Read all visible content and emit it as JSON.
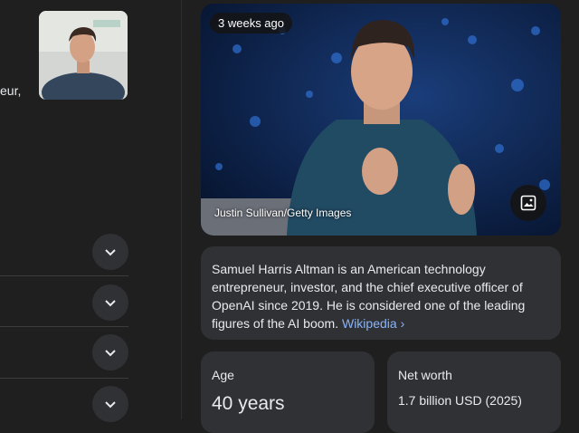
{
  "left": {
    "clipped_text": "eur,",
    "accordion_count": 4
  },
  "hero": {
    "timestamp": "3 weeks ago",
    "credit": "Justin Sullivan/Getty Images"
  },
  "description": {
    "text": "Samuel Harris Altman is an American technology entrepreneur, investor, and the chief executive officer of OpenAI since 2019. He is considered one of the leading figures of the AI boom.",
    "source_link": "Wikipedia",
    "source_chevron": "›"
  },
  "facts": {
    "age_label": "Age",
    "age_value": "40 years",
    "networth_label": "Net worth",
    "networth_value": "1.7 billion USD (2025)"
  },
  "icons": {
    "accordion": "chevron-down-icon",
    "image_button": "image-icon"
  },
  "colors": {
    "background": "#1f1f1f",
    "card": "#303134",
    "link": "#8ab4f8",
    "text": "#e8eaed"
  }
}
